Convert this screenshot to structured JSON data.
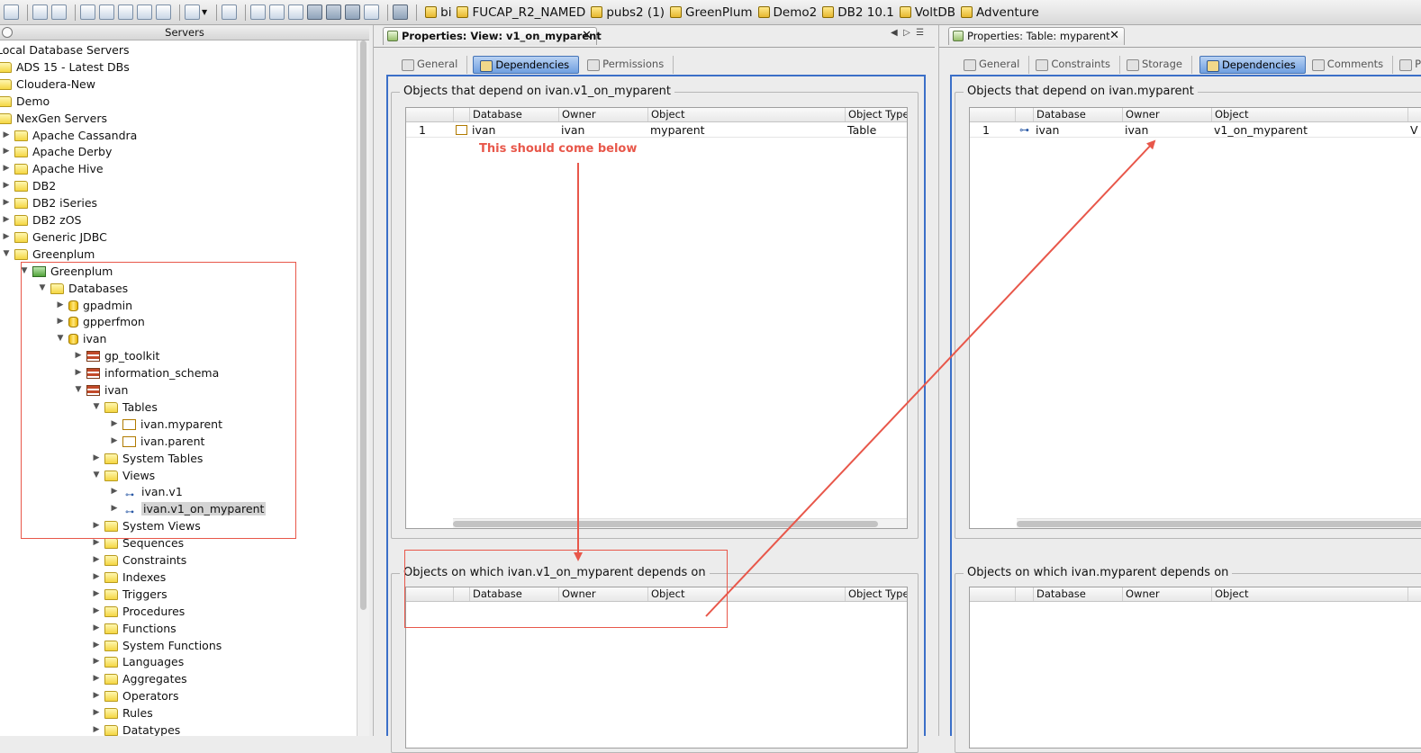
{
  "toolbar": {
    "connections": [
      "bi",
      "FUCAP_R2_NAMED",
      "pubs2 (1)",
      "GreenPlum",
      "Demo2",
      "DB2 10.1",
      "VoltDB",
      "Adventure"
    ]
  },
  "servers_panel": {
    "title": "Servers",
    "tree": [
      {
        "label": "Local Database Servers",
        "level": 0,
        "arrow": "",
        "icon": "none"
      },
      {
        "label": "ADS 15 - Latest DBs",
        "level": 0,
        "arrow": "",
        "icon": "folder"
      },
      {
        "label": "Cloudera-New",
        "level": 0,
        "arrow": "",
        "icon": "folder"
      },
      {
        "label": "Demo",
        "level": 0,
        "arrow": "",
        "icon": "folder"
      },
      {
        "label": "NexGen Servers",
        "level": 0,
        "arrow": "",
        "icon": "folder"
      },
      {
        "label": "Apache Cassandra",
        "level": 1,
        "arrow": "▶",
        "icon": "folder"
      },
      {
        "label": "Apache Derby",
        "level": 1,
        "arrow": "▶",
        "icon": "folder"
      },
      {
        "label": "Apache Hive",
        "level": 1,
        "arrow": "▶",
        "icon": "folder"
      },
      {
        "label": "DB2",
        "level": 1,
        "arrow": "▶",
        "icon": "folder"
      },
      {
        "label": "DB2 iSeries",
        "level": 1,
        "arrow": "▶",
        "icon": "folder"
      },
      {
        "label": "DB2 zOS",
        "level": 1,
        "arrow": "▶",
        "icon": "folder"
      },
      {
        "label": "Generic JDBC",
        "level": 1,
        "arrow": "▶",
        "icon": "folder"
      },
      {
        "label": "Greenplum",
        "level": 1,
        "arrow": "▼",
        "icon": "folder"
      },
      {
        "label": "Greenplum",
        "level": 2,
        "arrow": "▼",
        "icon": "server"
      },
      {
        "label": "Databases",
        "level": 3,
        "arrow": "▼",
        "icon": "folder"
      },
      {
        "label": "gpadmin",
        "level": 4,
        "arrow": "▶",
        "icon": "database"
      },
      {
        "label": "gpperfmon",
        "level": 4,
        "arrow": "▶",
        "icon": "database"
      },
      {
        "label": "ivan",
        "level": 4,
        "arrow": "▼",
        "icon": "database"
      },
      {
        "label": "gp_toolkit",
        "level": 5,
        "arrow": "▶",
        "icon": "schema"
      },
      {
        "label": "information_schema",
        "level": 5,
        "arrow": "▶",
        "icon": "schema"
      },
      {
        "label": "ivan",
        "level": 5,
        "arrow": "▼",
        "icon": "schema"
      },
      {
        "label": "Tables",
        "level": 6,
        "arrow": "▼",
        "icon": "folder"
      },
      {
        "label": "ivan.myparent",
        "level": 7,
        "arrow": "▶",
        "icon": "table"
      },
      {
        "label": "ivan.parent",
        "level": 7,
        "arrow": "▶",
        "icon": "table"
      },
      {
        "label": "System Tables",
        "level": 6,
        "arrow": "▶",
        "icon": "folder"
      },
      {
        "label": "Views",
        "level": 6,
        "arrow": "▼",
        "icon": "folder"
      },
      {
        "label": "ivan.v1",
        "level": 7,
        "arrow": "▶",
        "icon": "view"
      },
      {
        "label": "ivan.v1_on_myparent",
        "level": 7,
        "arrow": "▶",
        "icon": "view",
        "selected": true
      },
      {
        "label": "System Views",
        "level": 6,
        "arrow": "▶",
        "icon": "folder"
      },
      {
        "label": "Sequences",
        "level": 6,
        "arrow": "▶",
        "icon": "folder"
      },
      {
        "label": "Constraints",
        "level": 6,
        "arrow": "▶",
        "icon": "folder"
      },
      {
        "label": "Indexes",
        "level": 6,
        "arrow": "▶",
        "icon": "folder"
      },
      {
        "label": "Triggers",
        "level": 6,
        "arrow": "▶",
        "icon": "folder"
      },
      {
        "label": "Procedures",
        "level": 6,
        "arrow": "▶",
        "icon": "folder"
      },
      {
        "label": "Functions",
        "level": 6,
        "arrow": "▶",
        "icon": "folder"
      },
      {
        "label": "System Functions",
        "level": 6,
        "arrow": "▶",
        "icon": "folder"
      },
      {
        "label": "Languages",
        "level": 6,
        "arrow": "▶",
        "icon": "folder"
      },
      {
        "label": "Aggregates",
        "level": 6,
        "arrow": "▶",
        "icon": "folder"
      },
      {
        "label": "Operators",
        "level": 6,
        "arrow": "▶",
        "icon": "folder"
      },
      {
        "label": "Rules",
        "level": 6,
        "arrow": "▶",
        "icon": "folder"
      },
      {
        "label": "Datatypes",
        "level": 6,
        "arrow": "▶",
        "icon": "folder"
      }
    ]
  },
  "view_panel": {
    "tab_title": "Properties: View: v1_on_myparent",
    "close": "✕",
    "subtabs": [
      "General",
      "Dependencies",
      "Permissions"
    ],
    "active_subtab": "Dependencies",
    "top_group": {
      "label": "Objects that depend on ivan.v1_on_myparent",
      "columns": [
        "Database",
        "Owner",
        "Object",
        "Object Type"
      ],
      "rows": [
        {
          "num": "1",
          "database": "ivan",
          "owner": "ivan",
          "object": "myparent",
          "type": "Table"
        }
      ]
    },
    "bottom_group": {
      "label": "Objects on which ivan.v1_on_myparent depends on",
      "columns": [
        "Database",
        "Owner",
        "Object",
        "Object Type"
      ],
      "rows": []
    }
  },
  "table_panel": {
    "tab_title": "Properties: Table: myparent",
    "close": "✕",
    "subtabs": [
      "General",
      "Constraints",
      "Storage",
      "Dependencies",
      "Comments",
      "P"
    ],
    "active_subtab": "Dependencies",
    "top_group": {
      "label": "Objects that depend on ivan.myparent",
      "columns": [
        "Database",
        "Owner",
        "Object"
      ],
      "rows": [
        {
          "num": "1",
          "database": "ivan",
          "owner": "ivan",
          "object": "v1_on_myparent",
          "type": "V"
        }
      ]
    },
    "bottom_group": {
      "label": "Objects on which ivan.myparent depends on",
      "columns": [
        "Database",
        "Owner",
        "Object"
      ],
      "rows": []
    }
  },
  "annotation": {
    "text": "This should come below",
    "color": "#e8574a"
  }
}
